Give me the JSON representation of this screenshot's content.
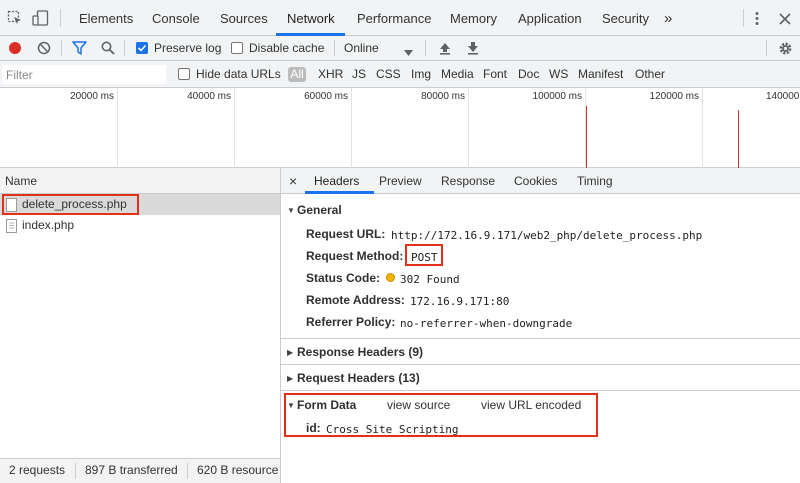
{
  "tabs": {
    "items": [
      "Elements",
      "Console",
      "Sources",
      "Network",
      "Performance",
      "Memory",
      "Application",
      "Security"
    ],
    "active": "Network",
    "more": "»"
  },
  "toolbar": {
    "preserve_log": "Preserve log",
    "disable_cache": "Disable cache",
    "throttle": "Online"
  },
  "filter": {
    "placeholder": "Filter",
    "hide_data_urls": "Hide data URLs",
    "all": "All",
    "types": [
      "XHR",
      "JS",
      "CSS",
      "Img",
      "Media",
      "Font",
      "Doc",
      "WS",
      "Manifest",
      "Other"
    ]
  },
  "overview": {
    "ticks": [
      "20000 ms",
      "40000 ms",
      "60000 ms",
      "80000 ms",
      "100000 ms",
      "120000 ms",
      "140000"
    ]
  },
  "requests": {
    "header": "Name",
    "items": [
      "delete_process.php",
      "index.php"
    ]
  },
  "statusbar": {
    "requests": "2 requests",
    "transferred": "897 B transferred",
    "resources": "620 B resource"
  },
  "details": {
    "close": "×",
    "tabs": [
      "Headers",
      "Preview",
      "Response",
      "Cookies",
      "Timing"
    ],
    "active_tab": "Headers",
    "general": {
      "title": "General",
      "request_url_key": "Request URL:",
      "request_url": "http://172.16.9.171/web2_php/delete_process.php",
      "request_method_key": "Request Method:",
      "request_method": "POST",
      "status_code_key": "Status Code:",
      "status_code": "302 Found",
      "remote_address_key": "Remote Address:",
      "remote_address": "172.16.9.171:80",
      "referrer_policy_key": "Referrer Policy:",
      "referrer_policy": "no-referrer-when-downgrade"
    },
    "response_headers": "Response Headers (9)",
    "request_headers": "Request Headers (13)",
    "form_data": {
      "title": "Form Data",
      "view_source": "view source",
      "view_url_encoded": "view URL encoded",
      "key": "id:",
      "value": "Cross Site Scripting"
    }
  },
  "colors": {
    "accent": "#1a73e8",
    "record": "#d93025",
    "highlight_box": "#e0321a",
    "status_warning": "#f4b400"
  }
}
